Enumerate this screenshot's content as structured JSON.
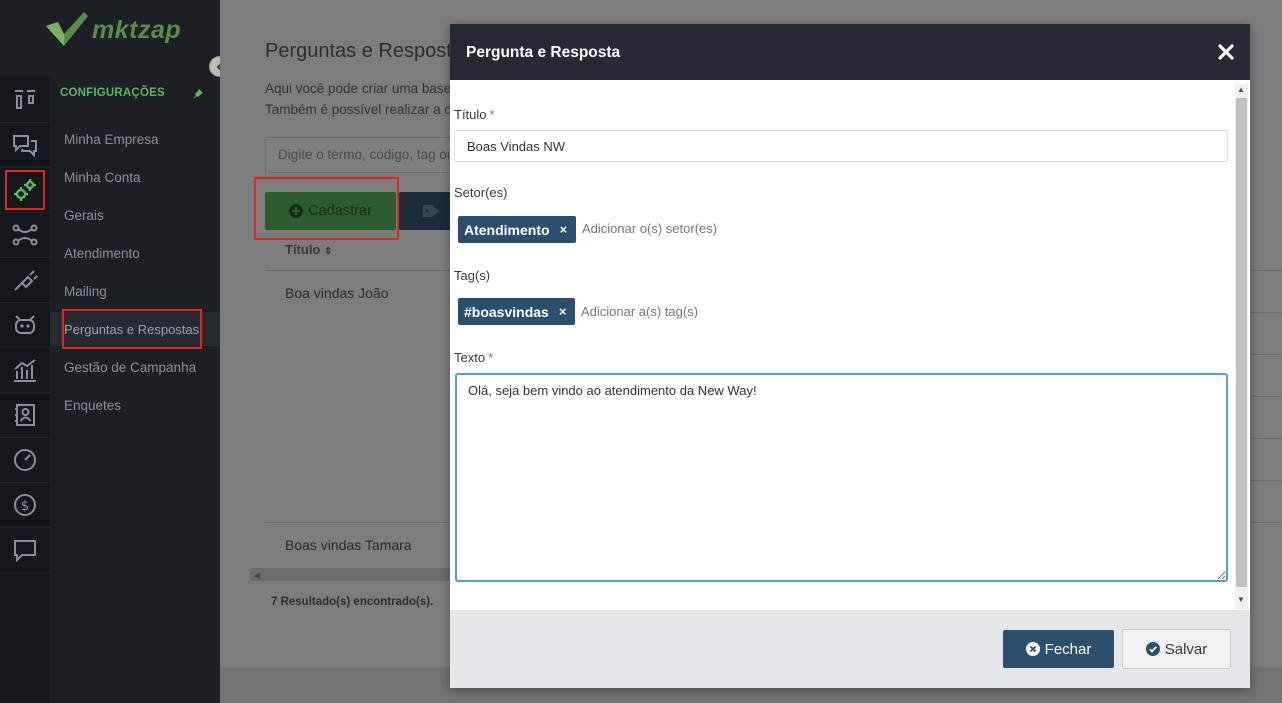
{
  "app": {
    "logo_text": "mktzap"
  },
  "sidebar": {
    "section_title": "CONFIGURAÇÕES",
    "items": [
      {
        "label": "Minha Empresa"
      },
      {
        "label": "Minha Conta"
      },
      {
        "label": "Gerais"
      },
      {
        "label": "Atendimento"
      },
      {
        "label": "Mailing"
      },
      {
        "label": "Perguntas e Respostas"
      },
      {
        "label": "Gestão de Campanha"
      },
      {
        "label": "Enquetes"
      }
    ],
    "active_item": "Perguntas e Respostas",
    "rail_icons": [
      "board-icon",
      "chat-icon",
      "gears-icon",
      "network-icon",
      "plug-icon",
      "robot-icon",
      "chart-icon",
      "contacts-icon",
      "speedometer-icon",
      "dollar-icon",
      "message-icon"
    ]
  },
  "main": {
    "title": "Perguntas e Respostas",
    "description_1": "Aqui você pode criar uma base",
    "description_2": "Também é possível realizar a cr",
    "search_placeholder": "Digite o termo, código, tag ou",
    "add_button_label": "Cadastrar",
    "column_title": "Título",
    "rows": [
      "Boa vindas João",
      "Boas vindas Tamara"
    ],
    "result_count": "7 Resultado(s) encontrado(s)."
  },
  "modal": {
    "title": "Pergunta e Resposta",
    "fields": {
      "title_label": "Título",
      "title_value": "Boas Vindas NW",
      "sectors_label": "Setor(es)",
      "sector_chip": "Atendimento",
      "sector_placeholder": "Adicionar o(s) setor(es)",
      "tags_label": "Tag(s)",
      "tag_chip": "#boasvindas",
      "tag_placeholder": "Adicionar a(s) tag(s)",
      "text_label": "Texto",
      "text_value": "Olá, seja bem vindo ao atendimento da New Way!",
      "required_mark": "*"
    },
    "buttons": {
      "close_label": "Fechar",
      "save_label": "Salvar"
    }
  },
  "colors": {
    "sidebar_bg": "#1c2024",
    "accent_green": "#5cb85c",
    "modal_header": "#252a33",
    "primary_blue": "#2c4f6e",
    "highlight_red": "#e0261f"
  }
}
